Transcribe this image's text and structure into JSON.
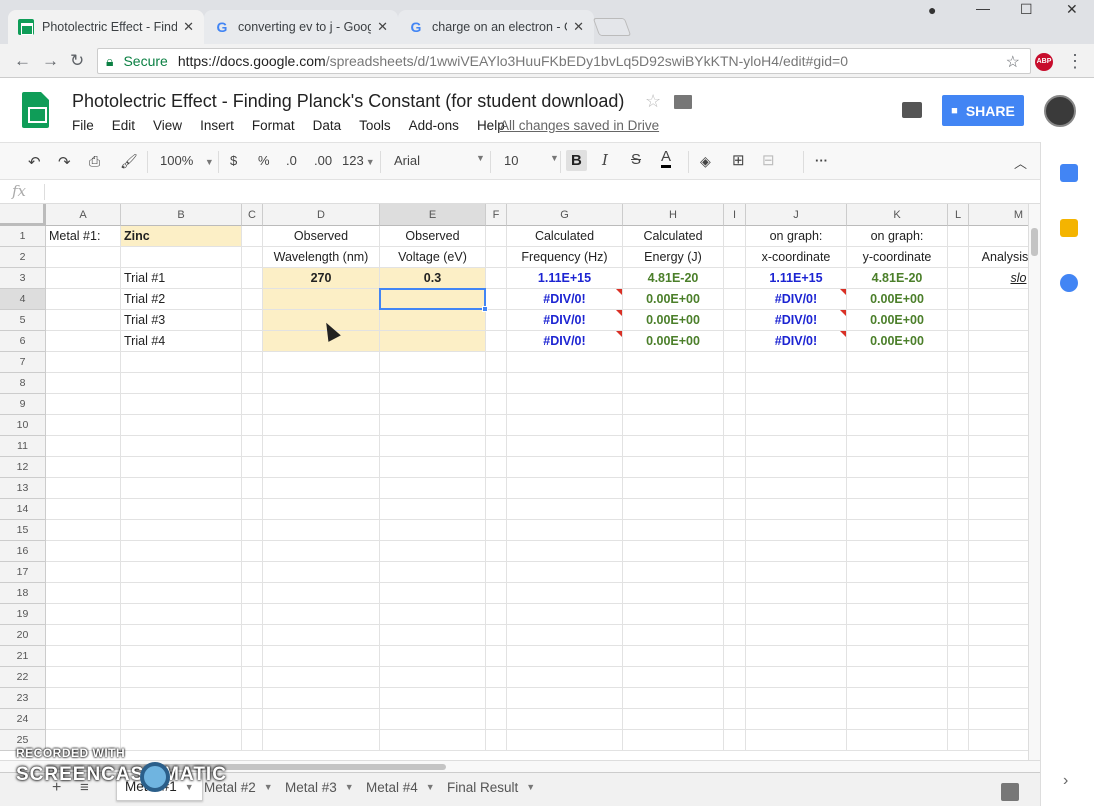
{
  "browser": {
    "tabs": [
      {
        "title": "Photolectric Effect - Findi",
        "icon": "sheets-favicon"
      },
      {
        "title": "converting ev to j - Goog",
        "icon": "google-favicon"
      },
      {
        "title": "charge on an electron - G",
        "icon": "google-favicon"
      }
    ],
    "secure_label": "Secure",
    "url_host": "https://docs.google.com",
    "url_path": "/spreadsheets/d/1wwiVEAYlo3HuuFKbEDy1bvLq5D92swiBYkKTN-yloH4/edit#gid=0",
    "abp_label": "ABP"
  },
  "doc": {
    "title": "Photolectric Effect - Finding Planck's Constant (for student download)",
    "menu": [
      "File",
      "Edit",
      "View",
      "Insert",
      "Format",
      "Data",
      "Tools",
      "Add-ons",
      "Help"
    ],
    "saved_status": "All changes saved in Drive",
    "share_label": "SHARE"
  },
  "toolbar": {
    "zoom": "100%",
    "currency": "$",
    "percent": "%",
    "dec_less": ".0",
    "dec_more": ".00",
    "format_more": "123",
    "font": "Arial",
    "font_size": "10",
    "bold": "B",
    "italic": "I",
    "strike": "S",
    "text_color": "A"
  },
  "grid": {
    "columns": [
      "A",
      "B",
      "C",
      "D",
      "E",
      "F",
      "G",
      "H",
      "I",
      "J",
      "K",
      "L",
      "M"
    ],
    "rows": [
      "1",
      "2",
      "3",
      "4",
      "5",
      "6",
      "7",
      "8",
      "9",
      "10",
      "11",
      "12",
      "13",
      "14",
      "15",
      "16",
      "17",
      "18",
      "19",
      "20",
      "21",
      "22",
      "23",
      "24",
      "25"
    ],
    "cells": {
      "A1": "Metal #1:",
      "B1": "Zinc",
      "D1": "Observed",
      "E1": "Observed",
      "G1": "Calculated",
      "H1": "Calculated",
      "J1": "on graph:",
      "K1": "on graph:",
      "D2": "Wavelength (nm)",
      "E2": "Voltage (eV)",
      "G2": "Frequency (Hz)",
      "H2": "Energy (J)",
      "J2": "x-coordinate",
      "K2": "y-coordinate",
      "M2": "Analysis of G",
      "B3": "Trial #1",
      "D3": "270",
      "E3": "0.3",
      "G3": "1.11E+15",
      "H3": "4.81E-20",
      "J3": "1.11E+15",
      "K3": "4.81E-20",
      "M3": "slo",
      "B4": "Trial #2",
      "G4": "#DIV/0!",
      "H4": "0.00E+00",
      "J4": "#DIV/0!",
      "K4": "0.00E+00",
      "B5": "Trial #3",
      "G5": "#DIV/0!",
      "H5": "0.00E+00",
      "J5": "#DIV/0!",
      "K5": "0.00E+00",
      "B6": "Trial #4",
      "G6": "#DIV/0!",
      "H6": "0.00E+00",
      "J6": "#DIV/0!",
      "K6": "0.00E+00"
    },
    "selected_cell": "E4"
  },
  "sheets": {
    "tabs": [
      "Metal #1",
      "Metal #2",
      "Metal #3",
      "Metal #4",
      "Final Result"
    ],
    "active": "Metal #1"
  },
  "watermark": {
    "line1": "RECORDED WITH",
    "line2": "SCREENCAST    MATIC"
  },
  "colors": {
    "input_fill": "#fcefc6",
    "blue_text": "#1c24d2",
    "green_text": "#4b7f2a",
    "share_blue": "#4285f4",
    "sheets_green": "#0f9d58"
  }
}
